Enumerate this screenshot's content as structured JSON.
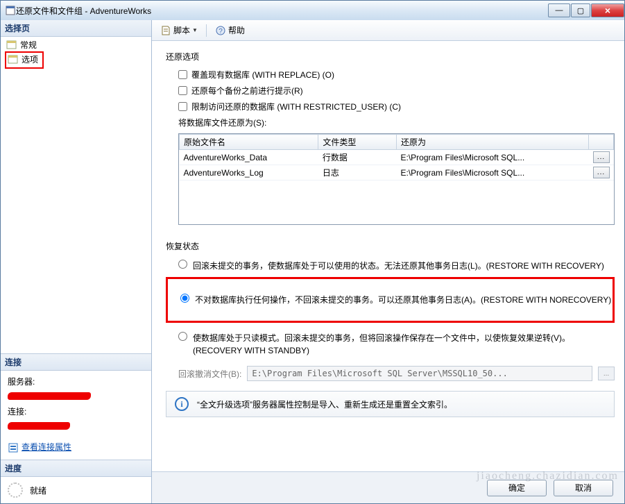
{
  "titlebar": {
    "text": "还原文件和文件组 - AdventureWorks"
  },
  "left": {
    "select_page_header": "选择页",
    "items": [
      {
        "label": "常规"
      },
      {
        "label": "选项"
      }
    ],
    "connection_header": "连接",
    "server_label": "服务器:",
    "conn_label": "连接:",
    "view_conn_link": "查看连接属性",
    "progress_header": "进度",
    "progress_status": "就绪"
  },
  "toolbar": {
    "script": "脚本",
    "help": "帮助"
  },
  "restore_options": {
    "title": "还原选项",
    "overwrite": "覆盖现有数据库 (WITH REPLACE) (O)",
    "prompt_each": "还原每个备份之前进行提示(R)",
    "restricted": "限制访问还原的数据库 (WITH RESTRICTED_USER) (C)",
    "restore_as_label": "将数据库文件还原为(S):"
  },
  "grid": {
    "headers": {
      "original": "原始文件名",
      "type": "文件类型",
      "restore_as": "还原为"
    },
    "rows": [
      {
        "original": "AdventureWorks_Data",
        "type": "行数据",
        "restore_as": "E:\\Program Files\\Microsoft SQL..."
      },
      {
        "original": "AdventureWorks_Log",
        "type": "日志",
        "restore_as": "E:\\Program Files\\Microsoft SQL..."
      }
    ]
  },
  "recovery": {
    "title": "恢复状态",
    "opt_recovery": "回滚未提交的事务，使数据库处于可以使用的状态。无法还原其他事务日志(L)。(RESTORE WITH RECOVERY)",
    "opt_norecovery": "不对数据库执行任何操作，不回滚未提交的事务。可以还原其他事务日志(A)。(RESTORE WITH NORECOVERY)",
    "opt_standby": "使数据库处于只读模式。回滚未提交的事务，但将回滚操作保存在一个文件中，以使恢复效果逆转(V)。(RECOVERY WITH STANDBY)",
    "standby_label": "回滚撤消文件(B):",
    "standby_value": "E:\\Program Files\\Microsoft SQL Server\\MSSQL10_50..."
  },
  "infobar": {
    "text": "“全文升级选项”服务器属性控制是导入、重新生成还是重置全文索引。"
  },
  "footer": {
    "ok": "确定",
    "cancel": "取消"
  },
  "watermark": "jiaocheng.chazidian.com"
}
